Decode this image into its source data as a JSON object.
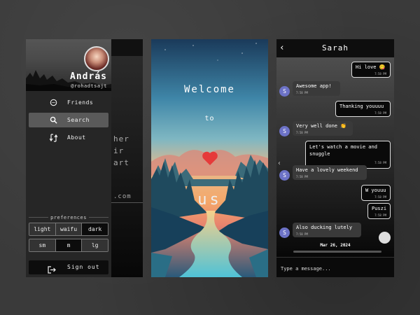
{
  "drawer": {
    "user_name": "András",
    "user_handle": "@rohadtsajt",
    "menu": [
      {
        "label": "Friends",
        "icon": "chat-bubble-icon",
        "active": false
      },
      {
        "label": "Search",
        "icon": "search-icon",
        "active": true
      },
      {
        "label": "About",
        "icon": "swap-icon",
        "active": false
      }
    ],
    "preferences_title": "preferences",
    "theme_options": [
      "light",
      "waifu",
      "dark"
    ],
    "theme_selected": "dark",
    "size_options": [
      "sm",
      "m",
      "lg"
    ],
    "size_selected": "m",
    "sign_out_label": "Sign out",
    "background_text": [
      "her",
      "ir",
      "art"
    ],
    "background_text_2": ".com"
  },
  "welcome": {
    "title": "Welcome",
    "connector": "to",
    "name": "us",
    "heart_color": "#e63a3a"
  },
  "chat": {
    "contact_name": "Sarah",
    "avatar_initial": "S",
    "avatar_color": "#6c72c6",
    "messages": [
      {
        "dir": "out",
        "text": "Hi love 😋",
        "time": "7:58 PM"
      },
      {
        "dir": "in",
        "text": "Awesome app!",
        "time": "7:58 PM"
      },
      {
        "dir": "out",
        "text": "Thanking youuuu",
        "time": "7:58 PM"
      },
      {
        "dir": "in",
        "text": "Very well done 👏",
        "time": "7:58 PM"
      },
      {
        "dir": "out",
        "text": "Let's watch a movie and snuggle",
        "time": "7:58 PM"
      },
      {
        "dir": "in",
        "text": "Have a lovely weekend",
        "time": "7:58 PM"
      },
      {
        "dir": "out",
        "text": "W youuu",
        "time": "7:58 PM"
      },
      {
        "dir": "out",
        "text": "Puszi",
        "time": "7:58 PM"
      },
      {
        "dir": "in",
        "text": "Also ducking lutely",
        "time": "7:58 PM"
      }
    ],
    "date_separator": "Mar 26, 2024",
    "input_placeholder": "Type a message..."
  }
}
